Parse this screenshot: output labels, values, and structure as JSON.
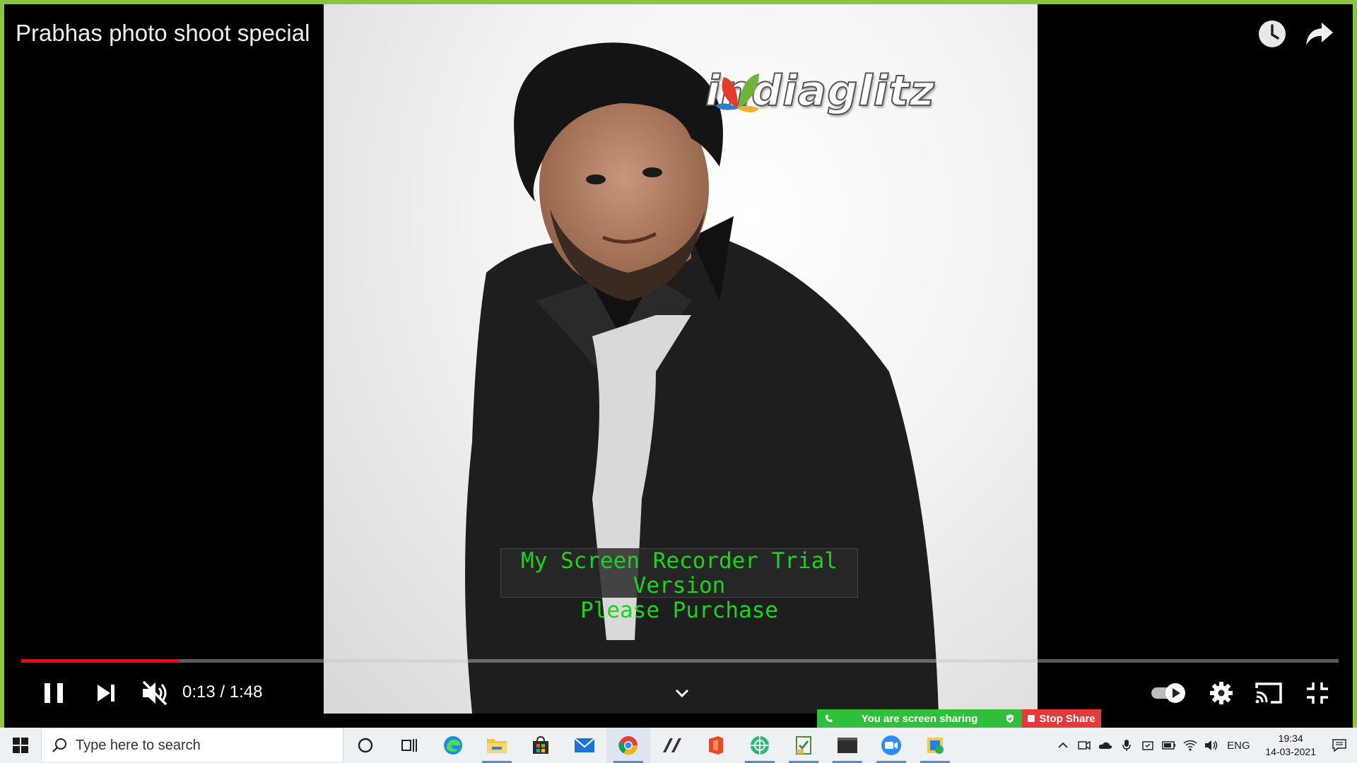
{
  "video": {
    "title": "Prabhas photo shoot special",
    "logo_text": "indiaglitz",
    "time_display": "0:13 / 1:48",
    "progress_fraction": 0.12,
    "watermark_line1": "My Screen Recorder Trial Version",
    "watermark_line2": "Please Purchase",
    "icons": {
      "watch_later": "clock-icon",
      "share": "share-icon",
      "pause": "pause-icon",
      "next": "next-icon",
      "mute": "volume-muted-icon",
      "more": "chevron-down-icon",
      "autoplay": "autoplay-toggle-icon",
      "settings": "gear-icon",
      "cast": "cast-icon",
      "fullscreen_exit": "exit-fullscreen-icon"
    }
  },
  "zoom": {
    "sharing_text": "You are screen sharing",
    "stop_label": "Stop Share",
    "colors": {
      "sharing": "#2fbf3a",
      "stop": "#e03c3c"
    }
  },
  "taskbar": {
    "search_placeholder": "Type here to search",
    "apps": [
      "cortana",
      "task-view",
      "edge",
      "file-explorer",
      "store",
      "mail",
      "chrome",
      "notepad-plus",
      "office",
      "network-app",
      "task-app",
      "terminal",
      "zoom",
      "paint-app"
    ],
    "tray": {
      "language": "ENG",
      "time": "19:34",
      "date": "14-03-2021"
    }
  },
  "colors": {
    "share_border": "#8bc53f",
    "progress": "#ff0000",
    "watermark_text": "#1bd41b"
  }
}
